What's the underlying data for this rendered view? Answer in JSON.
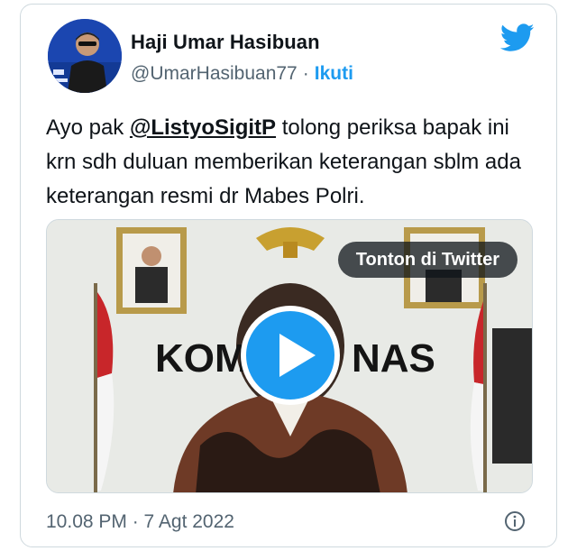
{
  "user": {
    "display_name": "Haji Umar Hasibuan",
    "handle": "@UmarHasibuan77",
    "separator": "·",
    "follow_label": "Ikuti"
  },
  "tweet": {
    "text_before": "Ayo pak ",
    "mention": "@ListyoSigitP",
    "text_after": " tolong periksa bapak ini krn sdh duluan memberikan keterangan sblm ada keterangan resmi dr Mabes Polri."
  },
  "media": {
    "watch_label": "Tonton di Twitter",
    "backdrop_text": [
      "KOM",
      "NAS"
    ]
  },
  "timestamp": "10.08 PM · 7 Agt 2022",
  "colors": {
    "accent": "#1d9bf0",
    "text": "#0f1419",
    "muted": "#536471"
  },
  "icons": [
    "twitter-bird-icon",
    "play-icon",
    "info-icon"
  ]
}
